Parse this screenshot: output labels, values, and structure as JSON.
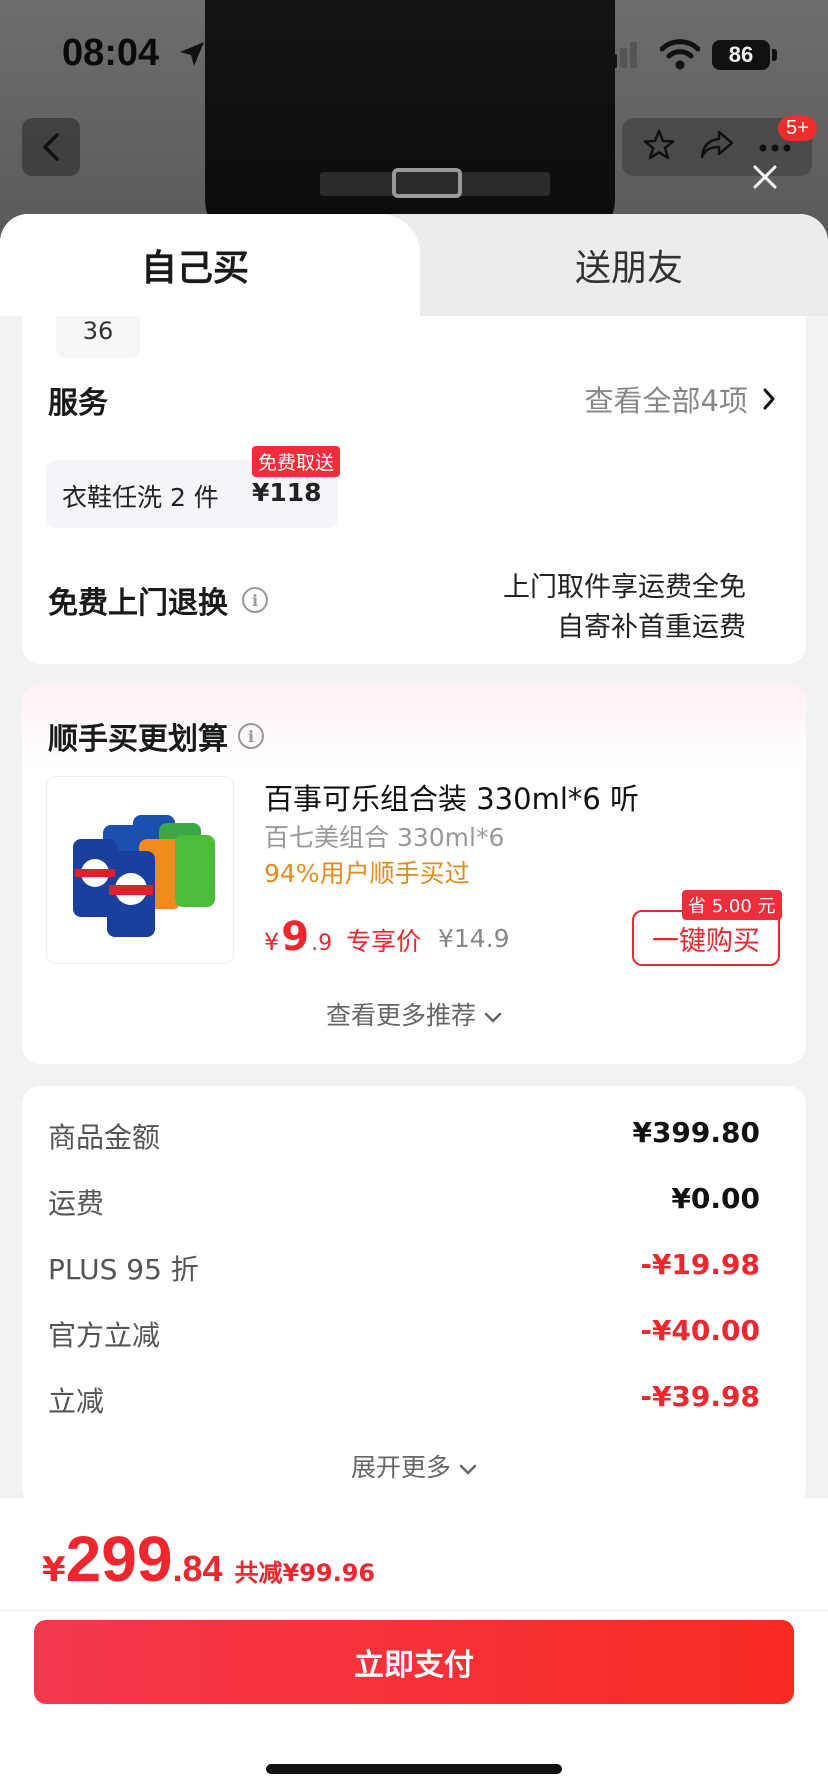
{
  "status_bar": {
    "time": "08:04",
    "battery": "86"
  },
  "header": {
    "notification_badge": "5+"
  },
  "tabs": {
    "self_buy": "自己买",
    "gift": "送朋友"
  },
  "size_card": {
    "selected_size": "36",
    "service_title": "服务",
    "service_link": "查看全部4项",
    "service_item": {
      "name": "衣鞋任洗 2 件",
      "price": "¥118",
      "tag": "免费取送"
    },
    "return_title": "免费上门退换",
    "return_line1": "上门取件享运费全免",
    "return_line2": "自寄补首重运费"
  },
  "addon": {
    "title": "顺手买更划算",
    "product_name": "百事可乐组合装 330ml*6 听",
    "product_sub": "百七美组合 330ml*6",
    "product_stat": "94%用户顺手买过",
    "price_currency": "¥",
    "price_int": "9",
    "price_dec": ".9",
    "price_label": "专享价",
    "old_price": "¥14.9",
    "buy_button": "一键购买",
    "save_tag": "省 5.00 元",
    "more": "查看更多推荐"
  },
  "summary": {
    "rows": [
      {
        "label": "商品金额",
        "value": "¥399.80"
      },
      {
        "label": "运费",
        "value": "¥0.00"
      },
      {
        "label": "PLUS 95 折",
        "value": "-¥19.98"
      },
      {
        "label": "官方立减",
        "value": "-¥40.00"
      },
      {
        "label": "立减",
        "value": "-¥39.98"
      }
    ],
    "expand": "展开更多"
  },
  "checkout": {
    "currency": "¥",
    "total_int": "299",
    "total_dec": ".84",
    "discount": "共减¥99.96",
    "pay_button": "立即支付"
  },
  "colors": {
    "accent_red": "#f0262e",
    "orange": "#e88a1a"
  }
}
